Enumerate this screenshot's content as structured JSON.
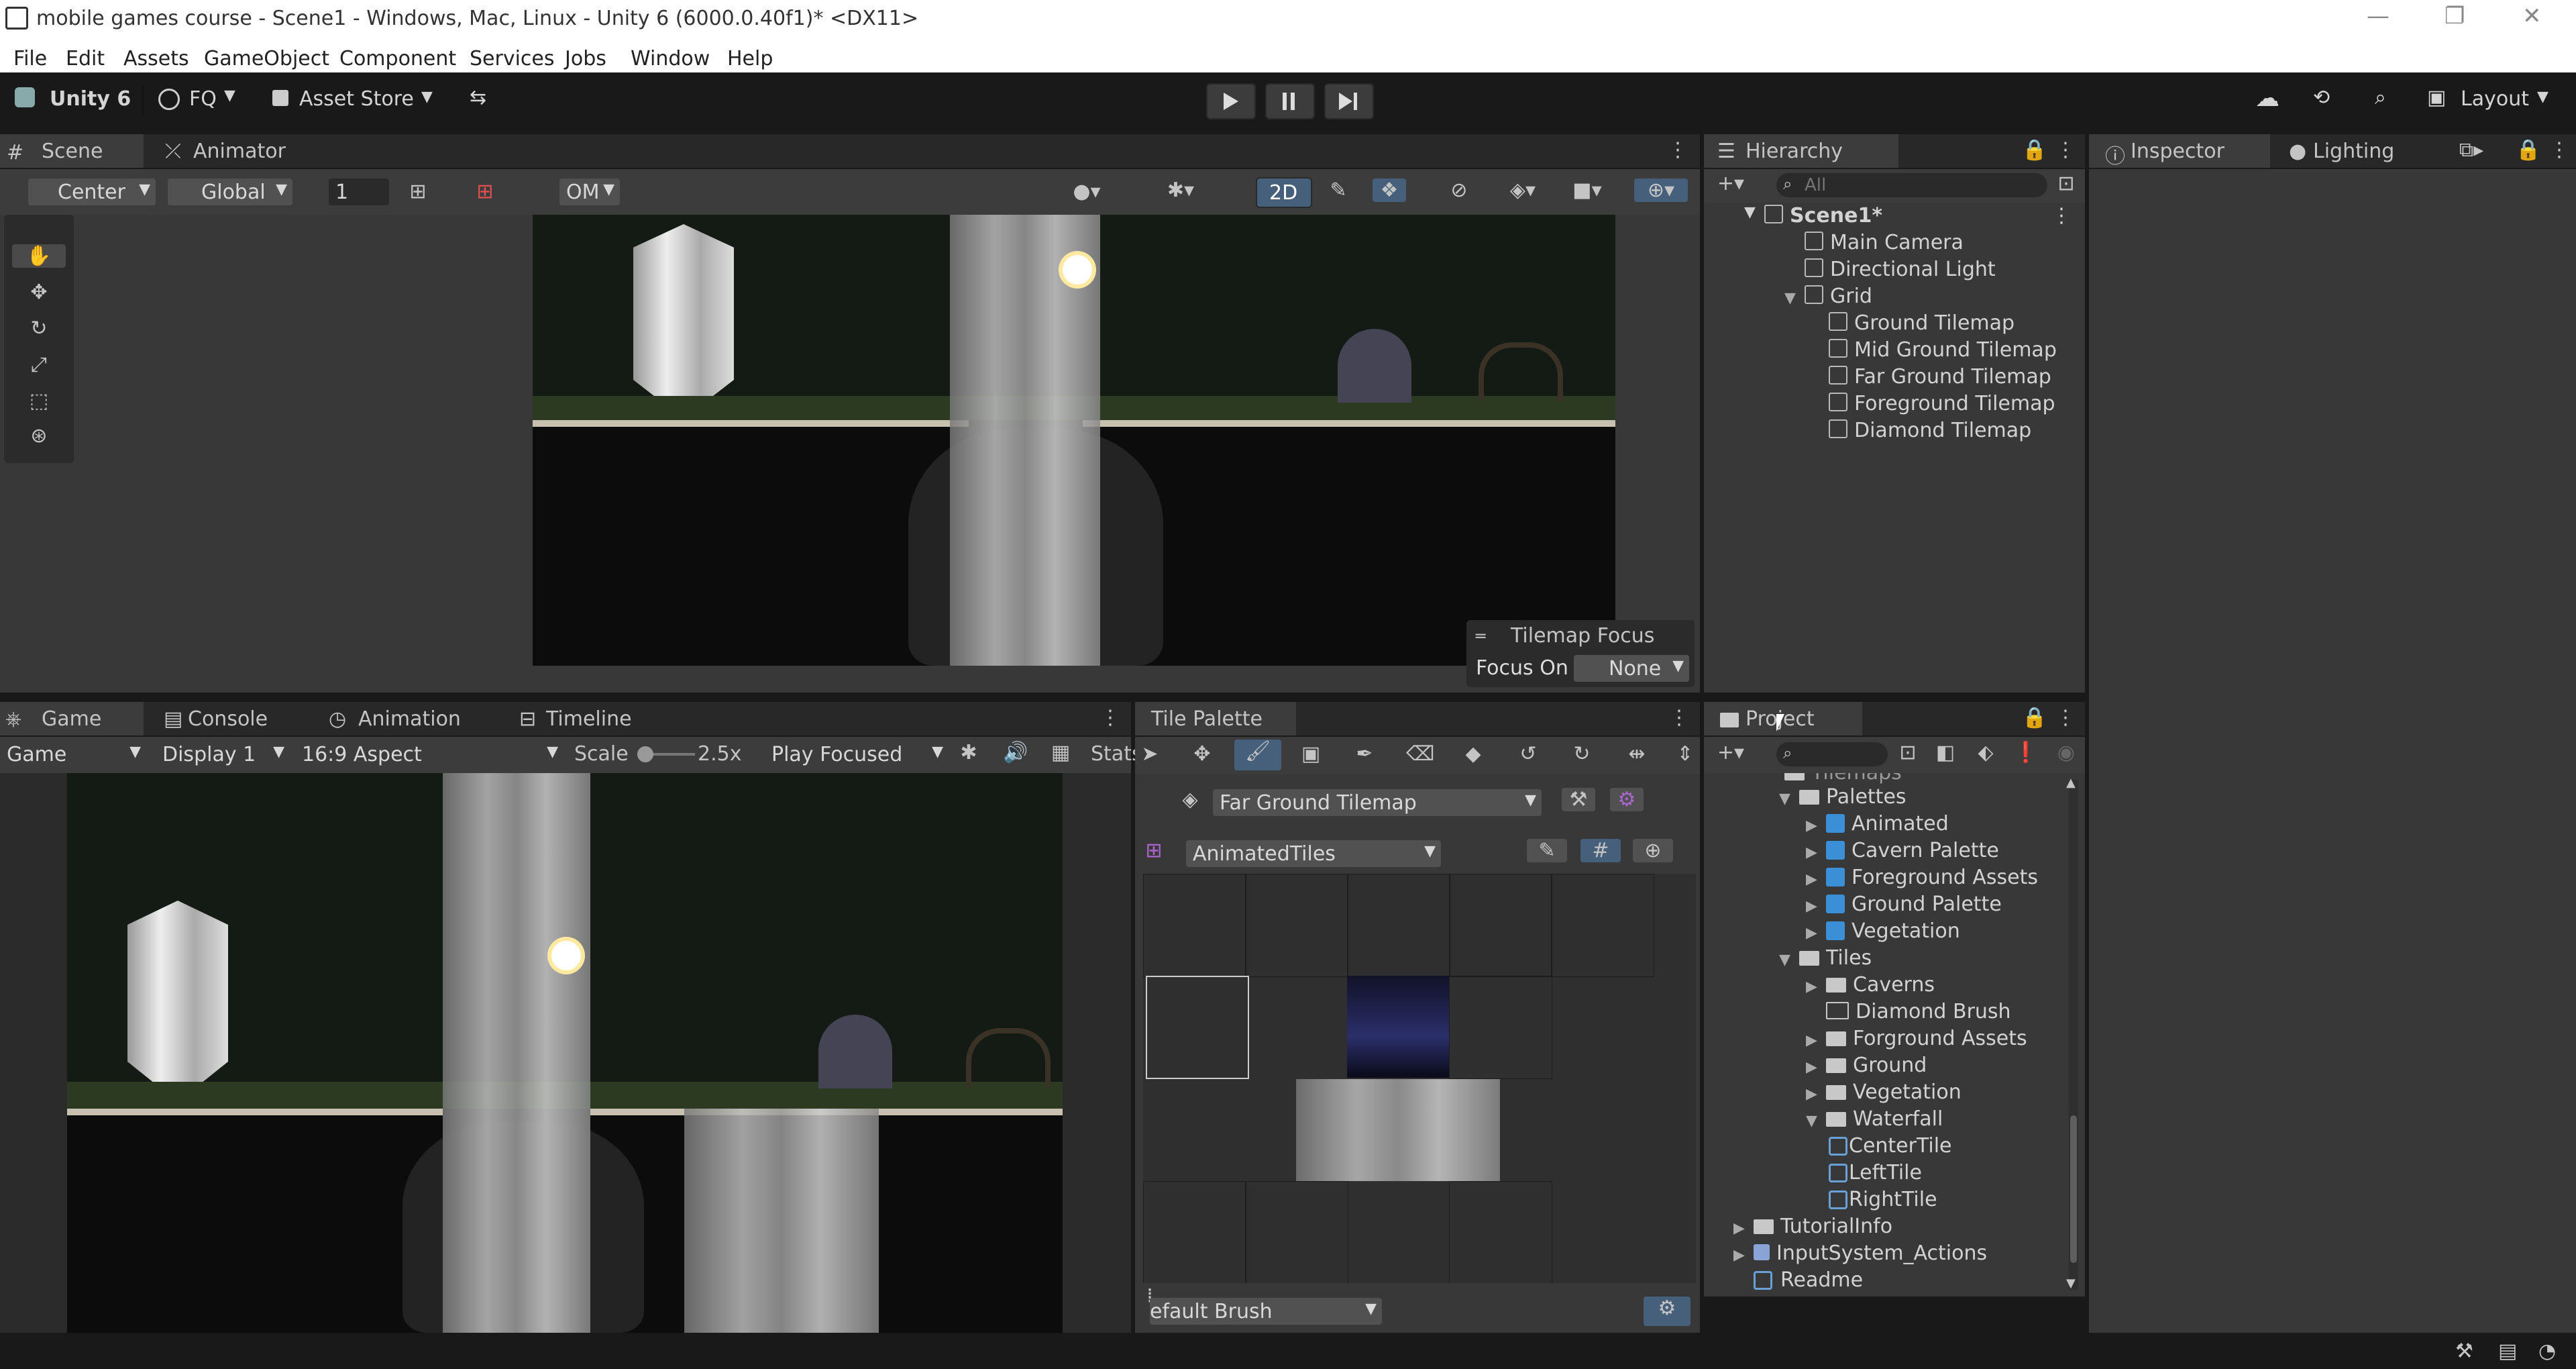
{
  "window": {
    "title": "mobile games course - Scene1 - Windows, Mac, Linux - Unity 6 (6000.0.40f1)* <DX11>",
    "minimize_icon": "minimize-icon",
    "maximize_icon": "restore-icon",
    "close_icon": "close-icon"
  },
  "menu": [
    "File",
    "Edit",
    "Assets",
    "GameObject",
    "Component",
    "Services",
    "Jobs",
    "Window",
    "Help"
  ],
  "toolbar": {
    "unity_label": "Unity 6",
    "account_label": "FQ",
    "asset_store_label": "Asset Store",
    "layout_label": "Layout"
  },
  "scene_panel": {
    "tabs": [
      "Scene",
      "Animator"
    ],
    "pivot_label": "Center",
    "space_label": "Global",
    "grid_value": "1",
    "om_label": "OM",
    "mode_2d_label": "2D",
    "tilemap_focus_title": "Tilemap Focus",
    "focus_on_label": "Focus On",
    "focus_on_value": "None"
  },
  "hierarchy": {
    "tab": "Hierarchy",
    "search_placeholder": "All",
    "scene_name": "Scene1*",
    "items": [
      {
        "label": "Main Camera",
        "depth": 1
      },
      {
        "label": "Directional Light",
        "depth": 1
      },
      {
        "label": "Grid",
        "depth": 1
      },
      {
        "label": "Ground Tilemap",
        "depth": 2
      },
      {
        "label": "Mid Ground Tilemap",
        "depth": 2
      },
      {
        "label": "Far Ground Tilemap",
        "depth": 2
      },
      {
        "label": "Foreground Tilemap",
        "depth": 2
      },
      {
        "label": "Diamond Tilemap",
        "depth": 2
      }
    ]
  },
  "inspector": {
    "tabs": [
      "Inspector",
      "Lighting"
    ]
  },
  "game_panel": {
    "tabs": [
      "Game",
      "Console",
      "Animation",
      "Timeline"
    ],
    "mode_label": "Game",
    "display_label": "Display 1",
    "aspect_label": "16:9 Aspect",
    "scale_label": "Scale",
    "scale_value": "2.5x",
    "play_focused_label": "Play Focused",
    "stats_label": "Stats"
  },
  "tile_palette": {
    "tab": "Tile Palette",
    "active_tilemap": "Far Ground Tilemap",
    "palette": "AnimatedTiles",
    "brush_label": "efault Brush"
  },
  "project": {
    "tab": "Project",
    "partial_top_label": "Tilemaps",
    "items": [
      {
        "label": "Palettes",
        "kind": "folder",
        "expanded": true
      },
      {
        "label": "Animated",
        "kind": "prefab"
      },
      {
        "label": "Cavern Palette",
        "kind": "prefab"
      },
      {
        "label": "Foreground Assets",
        "kind": "prefab"
      },
      {
        "label": "Ground Palette",
        "kind": "prefab"
      },
      {
        "label": "Vegetation",
        "kind": "prefab"
      },
      {
        "label": "Tiles",
        "kind": "folder",
        "expanded": true
      },
      {
        "label": "Caverns",
        "kind": "folder"
      },
      {
        "label": "Diamond Brush",
        "kind": "folder-empty"
      },
      {
        "label": "Forground Assets",
        "kind": "folder"
      },
      {
        "label": "Ground",
        "kind": "folder"
      },
      {
        "label": "Vegetation",
        "kind": "folder"
      },
      {
        "label": "Waterfall",
        "kind": "folder",
        "expanded": true
      },
      {
        "label": "CenterTile",
        "kind": "tile"
      },
      {
        "label": "LeftTile",
        "kind": "tile"
      },
      {
        "label": "RightTile",
        "kind": "tile"
      },
      {
        "label": "TutorialInfo",
        "kind": "folder"
      },
      {
        "label": "InputSystem_Actions",
        "kind": "asset"
      },
      {
        "label": "Readme",
        "kind": "asset"
      }
    ]
  },
  "colors": {
    "accent": "#3d5f8f",
    "background": "#191919",
    "panel": "#383838",
    "header": "#282828"
  }
}
